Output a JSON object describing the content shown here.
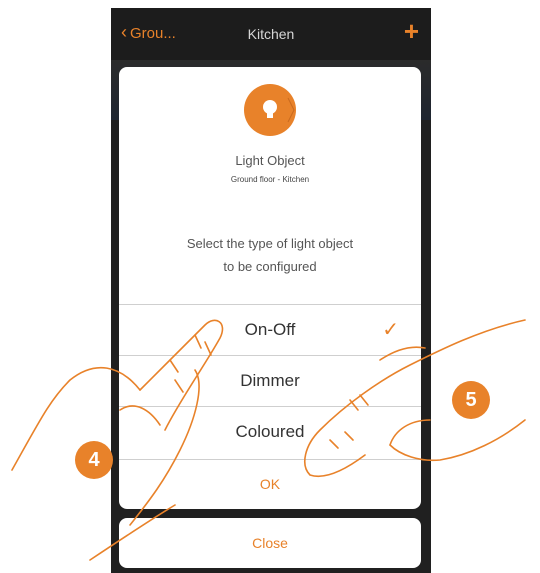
{
  "navbar": {
    "back_label": "Grou...",
    "title": "Kitchen",
    "add_icon": "plus-icon"
  },
  "dialog": {
    "icon": "lightbulb-icon",
    "title": "Light Object",
    "subtitle": "Ground floor - Kitchen",
    "instruction_line1": "Select the type of light object",
    "instruction_line2": "to be configured",
    "options": [
      {
        "label": "On-Off",
        "selected": true
      },
      {
        "label": "Dimmer",
        "selected": false
      },
      {
        "label": "Coloured",
        "selected": false
      }
    ],
    "ok_label": "OK"
  },
  "close_label": "Close",
  "steps": {
    "step_a": "4",
    "step_b": "5"
  },
  "colors": {
    "accent": "#e8822a",
    "frame": "#1c1c1c",
    "text": "#333333"
  }
}
